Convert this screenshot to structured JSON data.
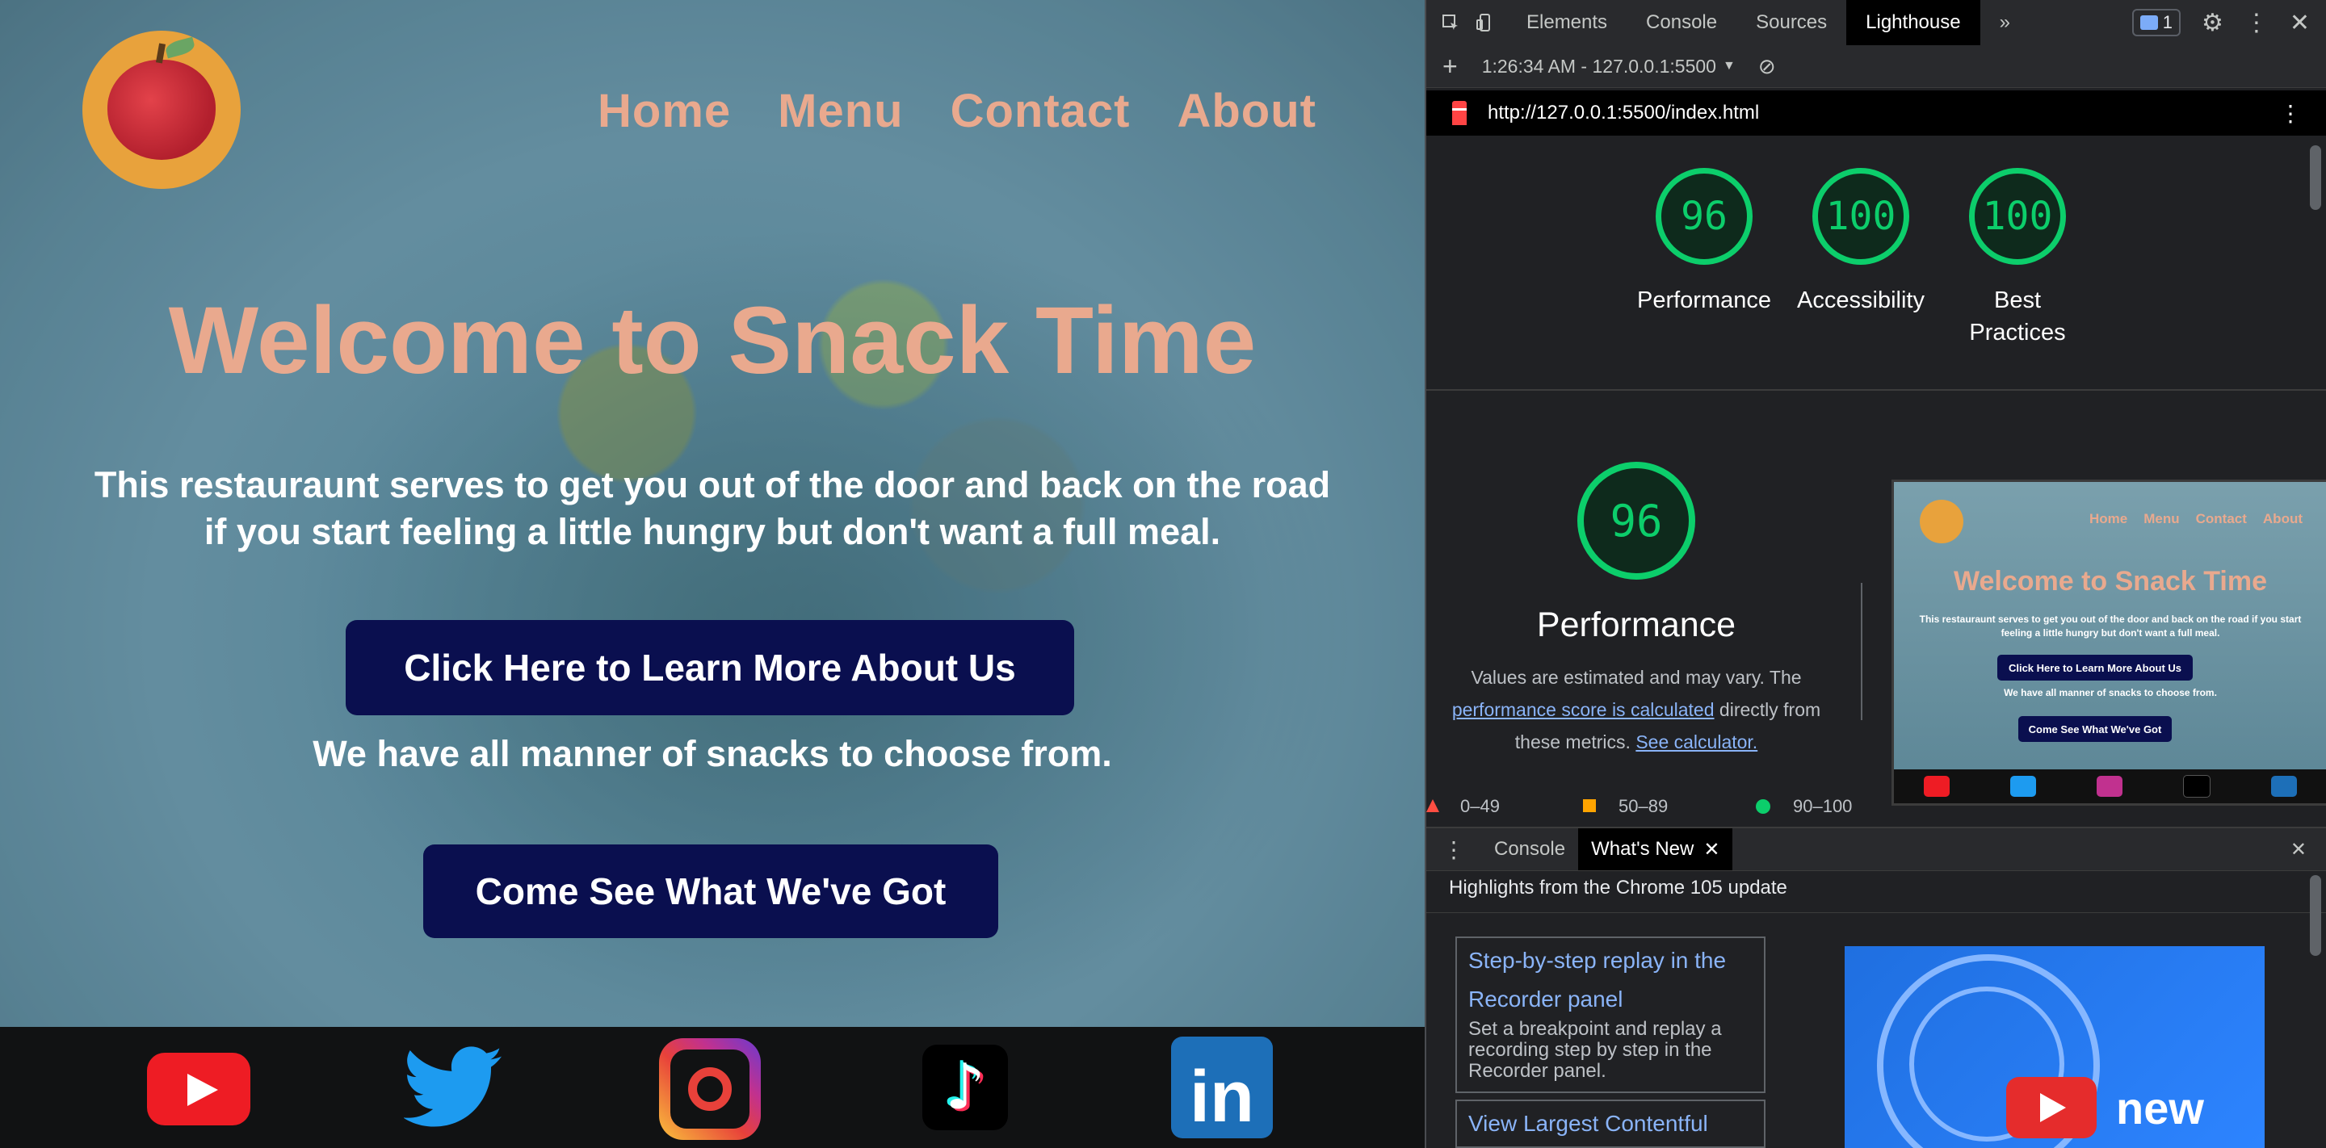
{
  "site": {
    "logo": "apple-clock-logo",
    "nav": [
      "Home",
      "Menu",
      "Contact",
      "About"
    ],
    "title": "Welcome to Snack Time",
    "description": "This restauraunt serves to get you out of the door and back on the road if you start feeling a little hungry but don't want a full meal.",
    "learn_more_button": "Click Here to Learn More About Us",
    "snacks_text": "We have all manner of snacks to choose from.",
    "menu_button": "Come See What We've Got",
    "social": [
      "youtube-icon",
      "twitter-icon",
      "instagram-icon",
      "tiktok-icon",
      "linkedin-icon"
    ],
    "colors": {
      "accent": "#e9a98e",
      "button": "#0a0f4f",
      "footer": "#111213"
    }
  },
  "devtools": {
    "tabs": [
      "Elements",
      "Console",
      "Sources",
      "Lighthouse"
    ],
    "active_tab": "Lighthouse",
    "more_tabs": "»",
    "issues_count": "1",
    "report_select": "1:26:34 AM - 127.0.0.1:5500",
    "url": "http://127.0.0.1:5500/index.html",
    "scores": [
      {
        "value": "96",
        "label": "Performance"
      },
      {
        "value": "100",
        "label": "Accessibility"
      },
      {
        "value": "100",
        "label": "Best Practices"
      }
    ],
    "performance": {
      "score": "96",
      "title": "Performance",
      "note_prefix": "Values are estimated and may vary. The",
      "note_link": "performance score is calculated",
      "note_middle": "directly from these metrics.",
      "note_link2": "See calculator."
    },
    "legend": {
      "fail": "0–49",
      "average": "50–89",
      "pass": "90–100"
    },
    "drawer": {
      "tabs": [
        "Console",
        "What's New"
      ],
      "active_tab": "What's New",
      "close": "✕",
      "highlight": "Highlights from the Chrome 105 update",
      "cards": [
        {
          "title": "Step-by-step replay in the Recorder panel",
          "desc": "Set a breakpoint and replay a recording step by step in the Recorder panel."
        },
        {
          "title": "View Largest Contentful",
          "desc": ""
        }
      ],
      "video_text": "new"
    },
    "colors": {
      "pass": "#0cce6b",
      "link": "#8ab4f8",
      "fail": "#ff4e42",
      "average": "#ffa400"
    }
  }
}
